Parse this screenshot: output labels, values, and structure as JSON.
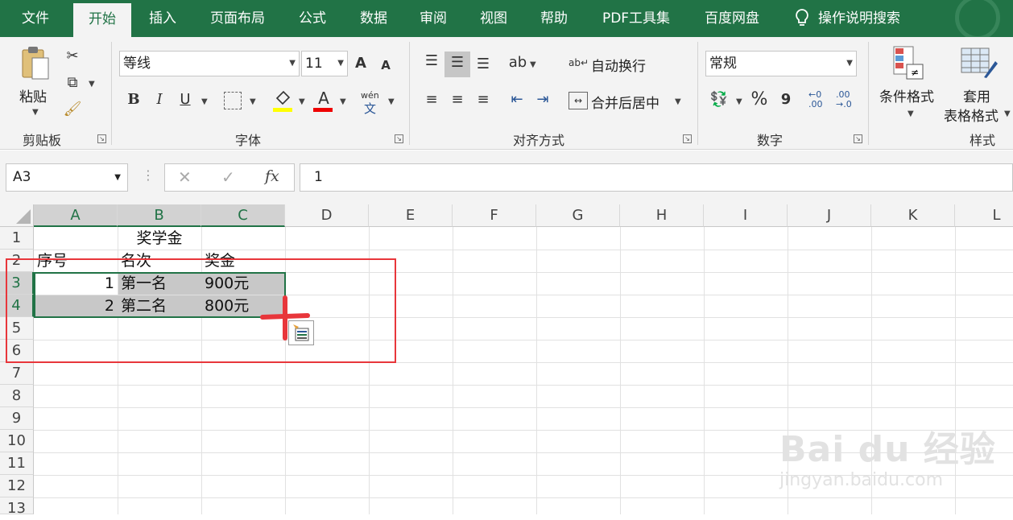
{
  "tabs": [
    "文件",
    "开始",
    "插入",
    "页面布局",
    "公式",
    "数据",
    "审阅",
    "视图",
    "帮助",
    "PDF工具集",
    "百度网盘",
    "操作说明搜索"
  ],
  "active_tab": "开始",
  "clipboard": {
    "paste": "粘贴",
    "group": "剪贴板"
  },
  "font": {
    "name": "等线",
    "size": "11",
    "grow": "A",
    "shrink": "A",
    "bold": "B",
    "italic": "I",
    "underline": "U",
    "font_color": "A",
    "phonetic_top": "wén",
    "phonetic_bottom": "文",
    "group": "字体"
  },
  "alignment": {
    "wrap": "自动换行",
    "merge": "合并后居中",
    "group": "对齐方式"
  },
  "number": {
    "format": "常规",
    "percent": "%",
    "comma": "9",
    "inc_decimal_top": "←0",
    "inc_decimal_bottom": ".00",
    "dec_decimal_top": ".00",
    "dec_decimal_bottom": "→.0",
    "group": "数字"
  },
  "styles": {
    "conditional": "条件格式",
    "table_format_1": "套用",
    "table_format_2": "表格格式",
    "group": "样式"
  },
  "formula_bar": {
    "name_box": "A3",
    "fx": "fx",
    "value": "1"
  },
  "columns": [
    "A",
    "B",
    "C",
    "D",
    "E",
    "F",
    "G",
    "H",
    "I",
    "J",
    "K",
    "L"
  ],
  "rows": [
    "1",
    "2",
    "3",
    "4",
    "5",
    "6",
    "7",
    "8",
    "9",
    "10",
    "11",
    "12",
    "13"
  ],
  "cells": {
    "title": "奖学金",
    "h_a": "序号",
    "h_b": "名次",
    "h_c": "奖金",
    "r3_a": "1",
    "r3_b": "第一名",
    "r3_c": "900元",
    "r4_a": "2",
    "r4_b": "第二名",
    "r4_c": "800元"
  },
  "colors": {
    "excel_green": "#217346",
    "annotation_red": "#e8363b",
    "selection_gray": "#c8c8c8"
  },
  "watermark": {
    "brand": "Bai du 经验",
    "url": "jingyan.baidu.com"
  }
}
